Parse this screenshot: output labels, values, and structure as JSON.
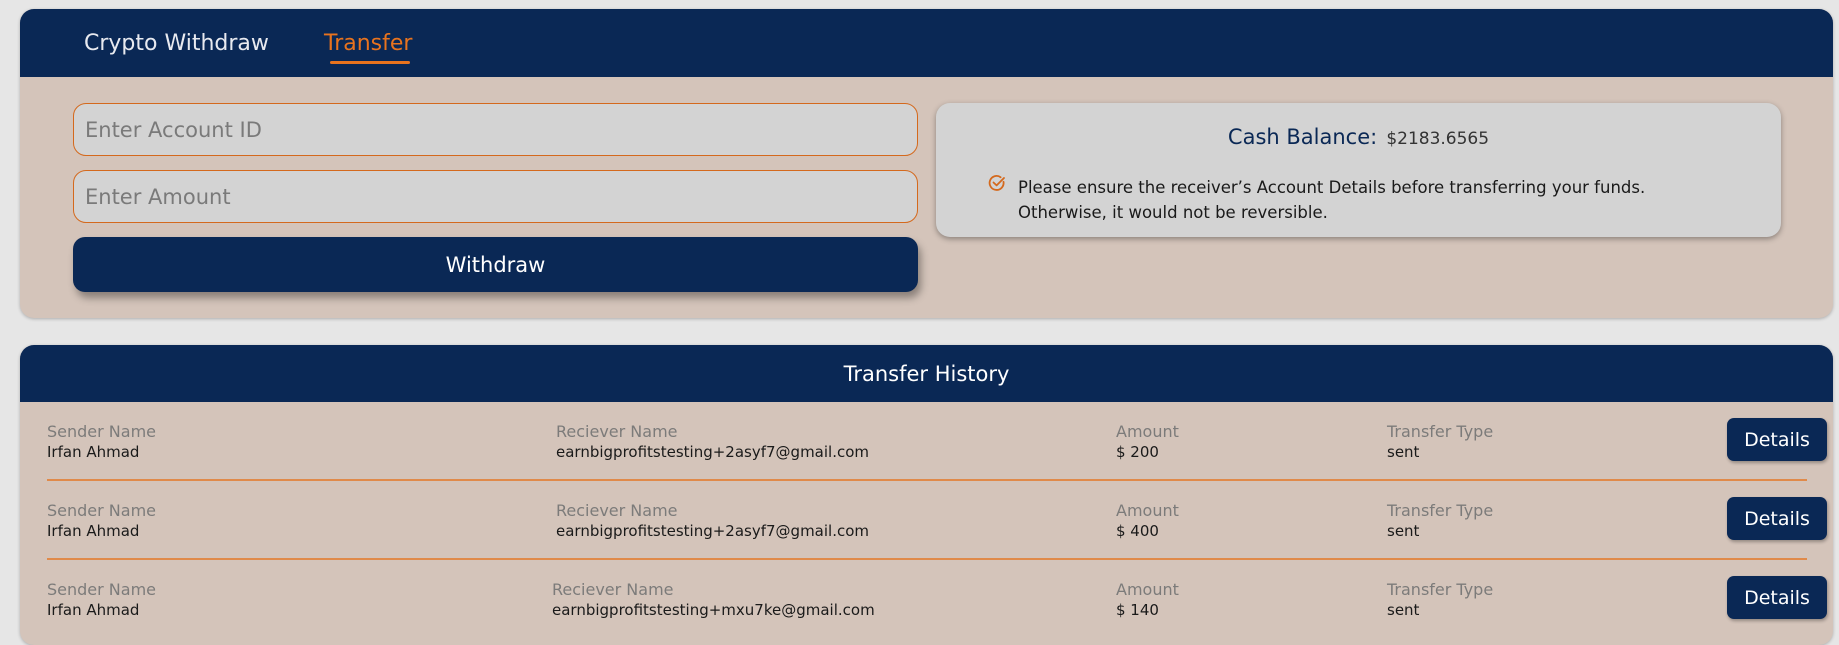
{
  "tabs": {
    "crypto_withdraw": "Crypto Withdraw",
    "transfer": "Transfer",
    "active": "Transfer",
    "active_color": "#e8731e"
  },
  "form": {
    "account_id_placeholder": "Enter Account ID",
    "amount_placeholder": "Enter Amount",
    "withdraw_label": "Withdraw"
  },
  "balance": {
    "label": "Cash Balance:",
    "value": "$2183.6565",
    "notice_icon": "check-circle-icon",
    "notice_line1": "Please ensure the receiver’s Account Details before transferring your funds.",
    "notice_line2": "Otherwise, it would not be reversible."
  },
  "history": {
    "title": "Transfer History",
    "columns": {
      "sender": "Sender Name",
      "receiver": "Reciever Name",
      "amount": "Amount",
      "type": "Transfer Type"
    },
    "details_label": "Details",
    "rows": [
      {
        "sender": "Irfan Ahmad",
        "receiver": "earnbigprofitstesting+2asyf7@gmail.com",
        "amount": "$ 200",
        "type": "sent"
      },
      {
        "sender": "Irfan Ahmad",
        "receiver": "earnbigprofitstesting+2asyf7@gmail.com",
        "amount": "$ 400",
        "type": "sent"
      },
      {
        "sender": "Irfan Ahmad",
        "receiver": "earnbigprofitstesting+mxu7ke@gmail.com",
        "amount": "$ 140",
        "type": "sent"
      }
    ]
  },
  "colors": {
    "navy": "#0a2855",
    "accent": "#e8731e",
    "panel": "#d4c4ba"
  }
}
